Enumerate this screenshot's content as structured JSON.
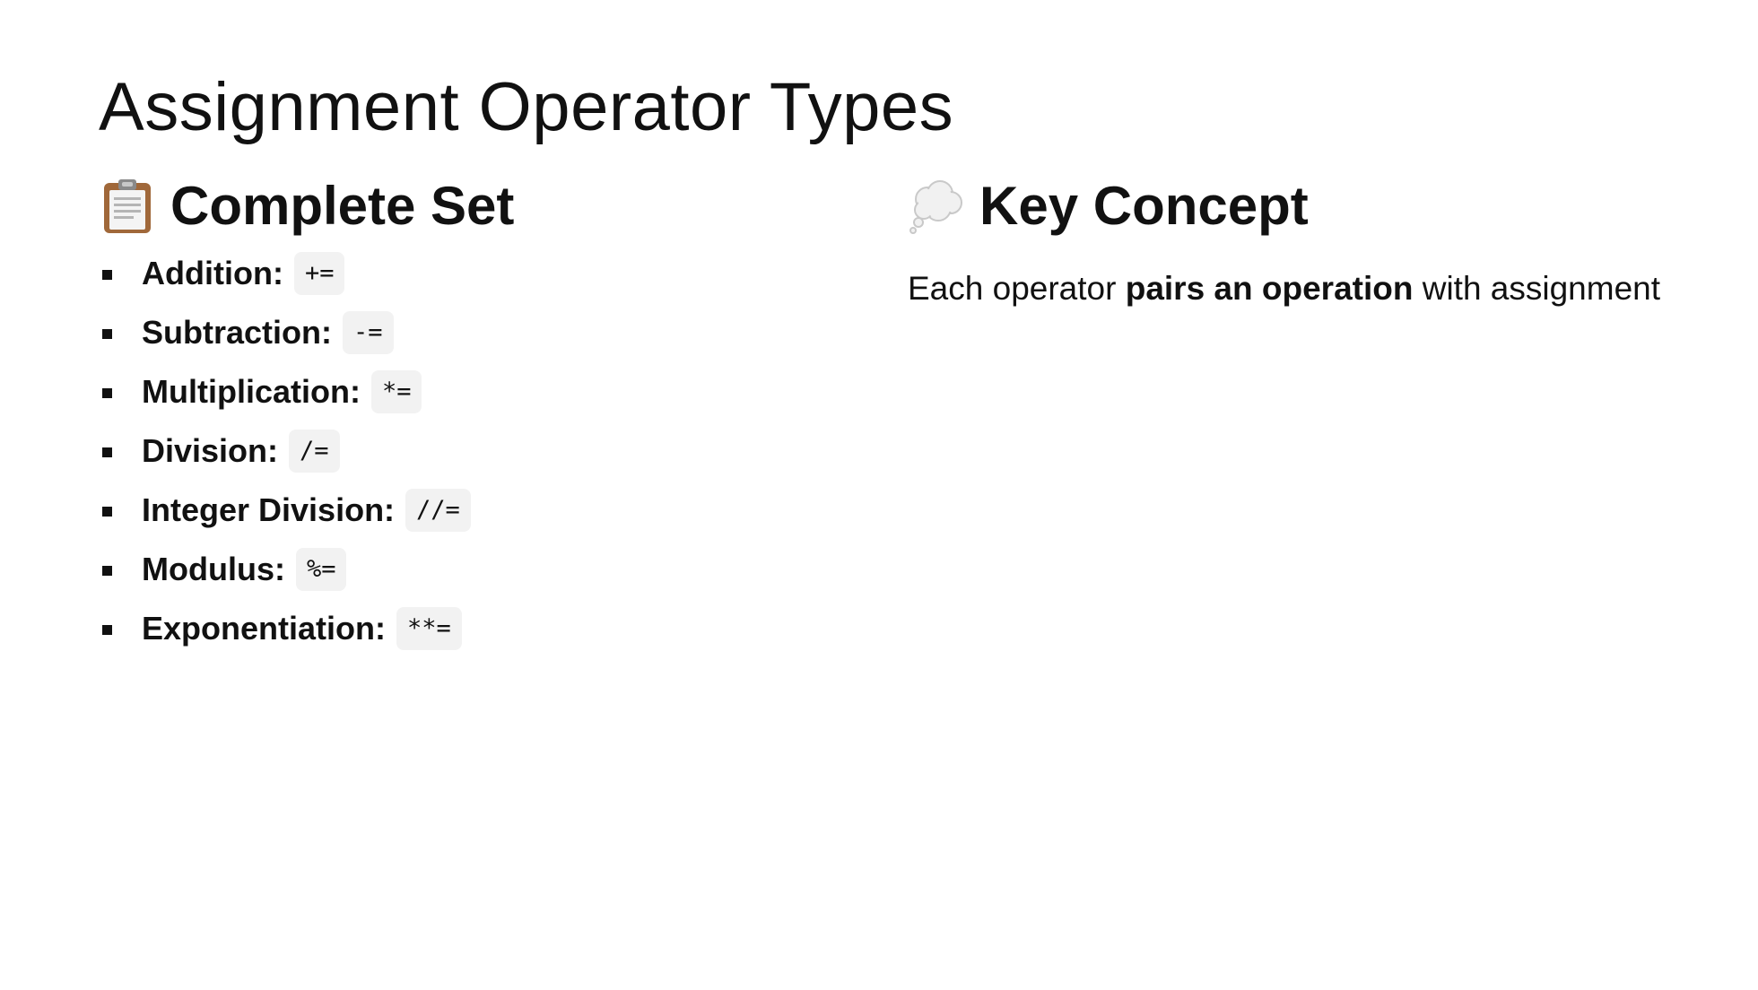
{
  "slide": {
    "title": "Assignment Operator Types"
  },
  "left": {
    "heading_icon": "clipboard-icon",
    "heading": "Complete Set",
    "operators": [
      {
        "label": "Addition:",
        "code": "+="
      },
      {
        "label": "Subtraction:",
        "code": "-="
      },
      {
        "label": "Multiplication:",
        "code": "*="
      },
      {
        "label": "Division:",
        "code": "/="
      },
      {
        "label": "Integer Division:",
        "code": "//="
      },
      {
        "label": "Modulus:",
        "code": "%="
      },
      {
        "label": "Exponentiation:",
        "code": "**="
      }
    ]
  },
  "right": {
    "heading_icon": "thought-bubble-icon",
    "heading": "Key Concept",
    "text_before": "Each operator ",
    "text_bold": "pairs an operation",
    "text_after": " with assignment"
  }
}
